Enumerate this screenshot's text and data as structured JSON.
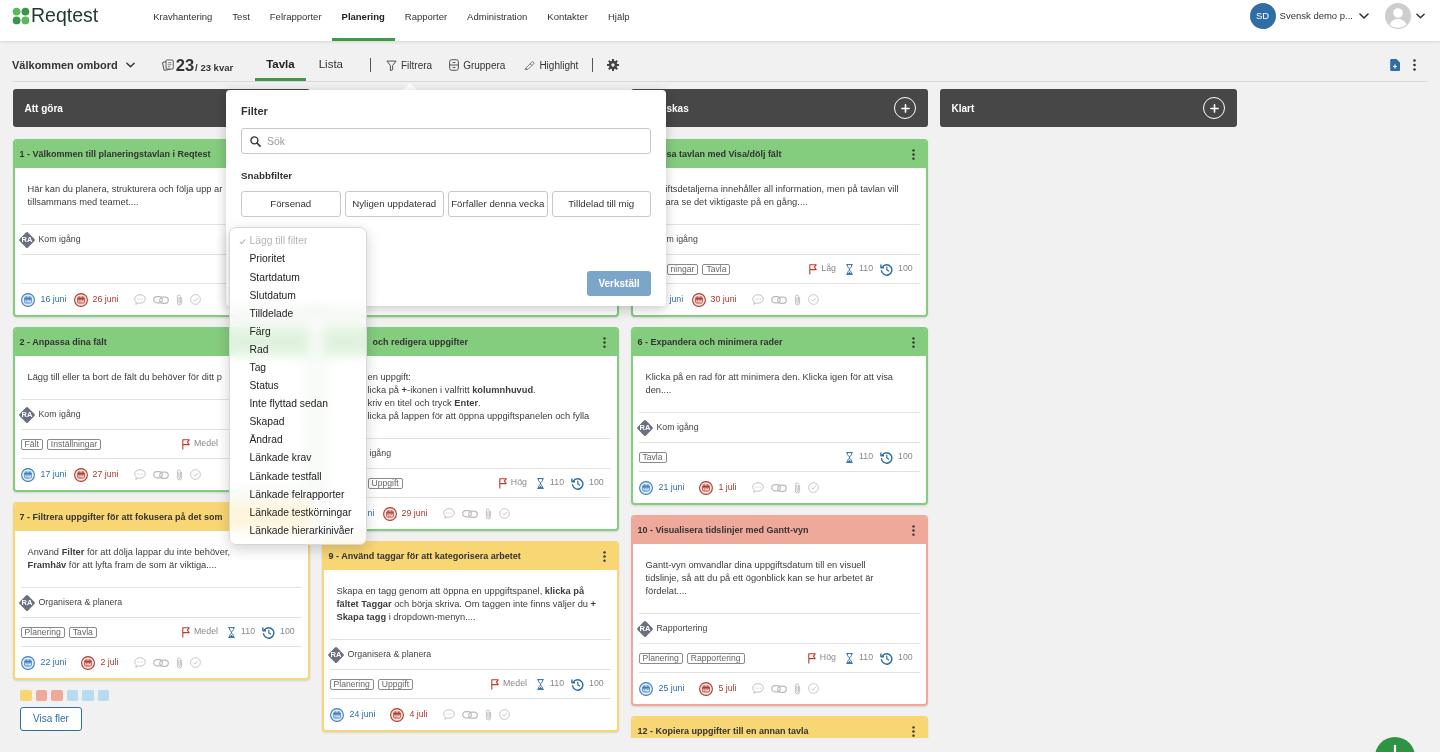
{
  "topbar": {
    "logo": "Reqtest",
    "nav": [
      {
        "label": "Kravhantering",
        "selected": false
      },
      {
        "label": "Test",
        "selected": false
      },
      {
        "label": "Felrapporter",
        "selected": false
      },
      {
        "label": "Planering",
        "selected": true
      },
      {
        "label": "Rapporter",
        "selected": false
      },
      {
        "label": "Administration",
        "selected": false
      },
      {
        "label": "Kontakter",
        "selected": false
      },
      {
        "label": "Hjälp",
        "selected": false
      }
    ],
    "project": {
      "initials": "SD",
      "name": "Svensk demo p..."
    }
  },
  "toolbar": {
    "board": "Välkommen ombord",
    "count": "23",
    "count_total": "/ 23 kvar",
    "views": [
      {
        "label": "Tavla",
        "selected": true
      },
      {
        "label": "Lista",
        "selected": false
      }
    ],
    "actions": [
      {
        "kind": "filter",
        "label": "Filtrera"
      },
      {
        "kind": "group",
        "label": "Gruppera"
      },
      {
        "kind": "highlight",
        "label": "Highlight"
      }
    ]
  },
  "columns": [
    {
      "title": "Att göra",
      "cards": [
        {
          "title": "1 - Välkommen till planeringstavlan i Reqtest",
          "color": "#84cc7e",
          "body": "Här kan du planera, strukturera och följa upp ar\ntillsammans med teamet....",
          "group_badge": "RA",
          "group": "Kom igång",
          "start": "16 juni",
          "end": "26 juni"
        },
        {
          "title": "2 - Anpassa dina fält",
          "color": "#84cc7e",
          "body": "Lägg till eller ta bort de fält du behöver för ditt p",
          "group_badge": "RA",
          "group": "Kom igång",
          "tags": [
            "Fält",
            "Inställningar"
          ],
          "priority": "Medel",
          "start": "17 juni",
          "end": "27 juni"
        },
        {
          "title": "7 - Filtrera uppgifter för att fokusera på det som",
          "color": "#f8d673",
          "body": "Använd **Filter** för att dölja lappar du inte behöver,\n**Framhäv** för att lyfta fram de som är viktiga....",
          "group_badge": "RA",
          "group": "Organisera & planera",
          "tags": [
            "Planering",
            "Tavla"
          ],
          "priority": "Medel",
          "estimate": "110",
          "remaining": "100",
          "start": "22 juni",
          "end": "2 juli"
        }
      ],
      "swatches": [
        {
          "color": "#f8d673"
        },
        {
          "color": "#eea99a"
        },
        {
          "color": "#eea99a"
        },
        {
          "color": "#b7dbf3"
        },
        {
          "color": "#b7dbf3"
        },
        {
          "color": "#b7dbf3"
        }
      ],
      "more_button": "Visa fler"
    },
    {
      "cards": [
        {
          "color": "#84cc7e"
        },
        {
          "title": "och redigera uppgifter",
          "color": "#84cc7e",
          "body": "en uppgift:\nlicka på **+**-ikonen i valfritt **kolumnhuvud**.\nkriv en titel och tryck **Enter**.\nlicka på lappen för att öppna uppgiftspanelen och fylla",
          "group": "igång",
          "tags": [
            "Uppgift"
          ],
          "priority": "Hög",
          "estimate": "110",
          "remaining": "100",
          "start": "ni",
          "end": "29 juni"
        },
        {
          "title": "9 - Använd taggar för att kategorisera arbetet",
          "color": "#f8d673",
          "body": "Skapa en tagg genom att öppna en uppgiftspanel, **klicka på**\n**fältet Taggar** och börja skriva. Om taggen inte finns väljer du **+**\n**Skapa tagg** i dropdown-menyn....",
          "group_badge": "RA",
          "group": "Organisera & planera",
          "tags": [
            "Planering",
            "Uppgift"
          ],
          "priority": "Medel",
          "estimate": "110",
          "remaining": "100",
          "start": "24 juni",
          "end": "4 juli"
        }
      ]
    },
    {
      "title": "skas",
      "cards": [
        {
          "title": "sa tavlan med Visa/dölj fält",
          "color": "#84cc7e",
          "body": "iftsdetaljerna innehåller all information, men på tavlan vill\nara se det viktigaste på en gång....",
          "group": "m igång",
          "tags": [
            "ningar",
            "Tavla"
          ],
          "priority": "Låg",
          "estimate": "110",
          "remaining": "100",
          "start": "juni",
          "end": "30 juni"
        },
        {
          "title": "6 - Expandera och minimera rader",
          "color": "#84cc7e",
          "body": "Klicka på en rad för att minimera den. Klicka igen för att visa\nden....",
          "group_badge": "RA",
          "group": "Kom igång",
          "tags": [
            "Tavla"
          ],
          "estimate": "110",
          "remaining": "100",
          "start": "21 juni",
          "end": "1 juli"
        },
        {
          "title": "10 - Visualisera tidslinjer med Gantt-vyn",
          "color": "#eea99a",
          "body": "Gantt-vyn omvandlar dina uppgiftsdatum till en visuell\ntidslinje, så att du på ett ögonblick kan se hur arbetet är\nfördelat....",
          "group_badge": "RA",
          "group": "Rapportering",
          "tags": [
            "Planering",
            "Rapportering"
          ],
          "priority": "Hög",
          "estimate": "110",
          "remaining": "100",
          "start": "25 juni",
          "end": "5 juli"
        },
        {
          "title": "12 - Kopiera uppgifter till en annan tavla",
          "color": "#f8d673"
        }
      ]
    },
    {
      "title": "Klart"
    }
  ],
  "filter_popup": {
    "title": "Filter",
    "search": {
      "placeholder": "Sök"
    },
    "quick_title": "Snabbfilter",
    "quick_filters": [
      {
        "label": "Försenad",
        "selected": false
      },
      {
        "label": "Nyligen uppdaterad",
        "selected": false
      },
      {
        "label": "Förfaller denna vecka",
        "selected": false
      },
      {
        "label": "Tilldelad till mig",
        "selected": false
      }
    ],
    "apply": {
      "label": "Verkställ",
      "disabled": true
    }
  },
  "filter_menu": {
    "items": [
      {
        "label": "Lägg till filter",
        "selected": true,
        "disabled": true
      },
      {
        "label": "Prioritet",
        "selected": false,
        "disabled": false
      },
      {
        "label": "Startdatum",
        "selected": false,
        "disabled": false
      },
      {
        "label": "Slutdatum",
        "selected": false,
        "disabled": false
      },
      {
        "label": "Tilldelade",
        "selected": false,
        "disabled": false
      },
      {
        "label": "Färg",
        "selected": false,
        "disabled": false
      },
      {
        "label": "Rad",
        "selected": false,
        "disabled": false
      },
      {
        "label": "Tag",
        "selected": false,
        "disabled": false
      },
      {
        "label": "Status",
        "selected": false,
        "disabled": false
      },
      {
        "label": "Inte flyttad sedan",
        "selected": false,
        "disabled": false
      },
      {
        "label": "Skapad",
        "selected": false,
        "disabled": false
      },
      {
        "label": "Ändrad",
        "selected": false,
        "disabled": false
      },
      {
        "label": "Länkade krav",
        "selected": false,
        "disabled": false
      },
      {
        "label": "Länkade testfall",
        "selected": false,
        "disabled": false
      },
      {
        "label": "Länkade felrapporter",
        "selected": false,
        "disabled": false
      },
      {
        "label": "Länkade testkörningar",
        "selected": false,
        "disabled": false
      },
      {
        "label": "Länkade hierarkinivåer",
        "selected": false,
        "disabled": false
      }
    ]
  }
}
